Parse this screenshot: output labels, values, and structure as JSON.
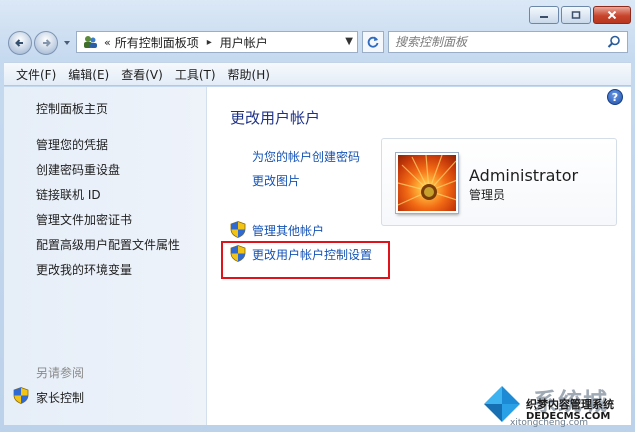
{
  "window": {
    "minimize_label": "minimize",
    "maximize_label": "maximize",
    "close_label": "close"
  },
  "address_bar": {
    "overflow_chevron": "«",
    "breadcrumbs": [
      "所有控制面板项",
      "用户帐户"
    ],
    "separator": "▸",
    "dropdown_arrow": "▼"
  },
  "search": {
    "placeholder": "搜索控制面板"
  },
  "menu": {
    "items": [
      "文件(F)",
      "编辑(E)",
      "查看(V)",
      "工具(T)",
      "帮助(H)"
    ]
  },
  "sidebar": {
    "items": [
      {
        "label": "控制面板主页"
      },
      {
        "label": "管理您的凭据"
      },
      {
        "label": "创建密码重设盘"
      },
      {
        "label": "链接联机 ID"
      },
      {
        "label": "管理文件加密证书"
      },
      {
        "label": "配置高级用户配置文件属性"
      },
      {
        "label": "更改我的环境变量"
      }
    ],
    "see_also": "另请参阅",
    "parental_control": "家长控制"
  },
  "main": {
    "help": "?",
    "title": "更改用户帐户",
    "tasks": [
      {
        "label": "为您的帐户创建密码",
        "shield": false
      },
      {
        "label": "更改图片",
        "shield": false
      },
      {
        "label": "管理其他帐户",
        "shield": true
      },
      {
        "label": "更改用户帐户控制设置",
        "shield": true
      }
    ],
    "user": {
      "name": "Administrator",
      "role": "管理员"
    }
  },
  "watermark": {
    "brand": "系统城",
    "site_name": "织梦内容管理系统",
    "domain": "DEDECMS.COM",
    "url": "xitongcheng.com"
  },
  "colors": {
    "link": "#1553b4",
    "title": "#1e3287",
    "highlight_box": "#e0131b"
  }
}
